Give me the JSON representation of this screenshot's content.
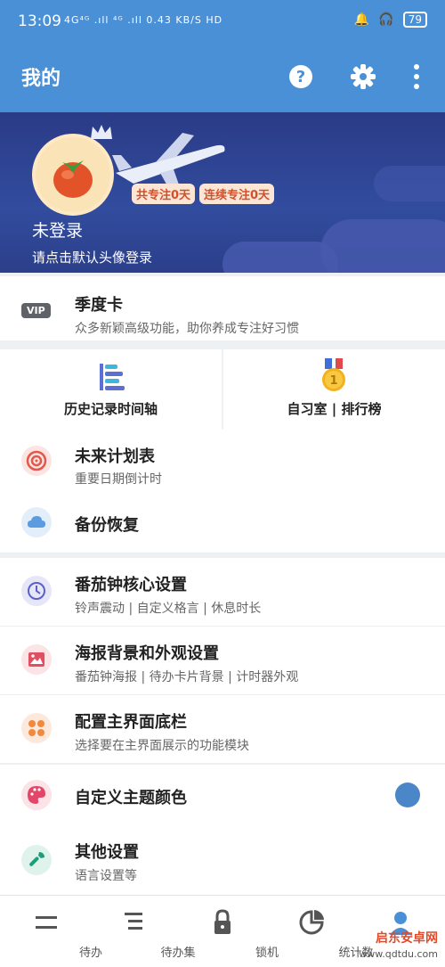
{
  "status": {
    "time": "13:09",
    "signal": "4G⁴ᴳ .ıll ⁴ᴳ .ıll 0.43 KB/S HD",
    "battery": "79"
  },
  "header": {
    "title": "我的"
  },
  "profile": {
    "badge_total": "共专注0天",
    "badge_streak": "连续专注0天",
    "name": "未登录",
    "hint": "请点击默认头像登录"
  },
  "vip": {
    "tag": "VIP",
    "title": "季度卡",
    "subtitle": "众多新颖高级功能，助你养成专注好习惯"
  },
  "grid": {
    "history": "历史记录时间轴",
    "study_room": "自习室 | 排行榜",
    "medal_number": "1"
  },
  "rows": {
    "future": {
      "title": "未来计划表",
      "subtitle": "重要日期倒计时"
    },
    "backup": {
      "title": "备份恢复"
    },
    "core": {
      "title": "番茄钟核心设置",
      "subtitle": "铃声震动 | 自定义格言 | 休息时长"
    },
    "poster": {
      "title": "海报背景和外观设置",
      "subtitle": "番茄钟海报 | 待办卡片背景 | 计时器外观"
    },
    "bottombar": {
      "title": "配置主界面底栏",
      "subtitle": "选择要在主界面展示的功能模块"
    },
    "theme": {
      "title": "自定义主题颜色"
    },
    "other": {
      "title": "其他设置",
      "subtitle": "语言设置等"
    }
  },
  "colors": {
    "primary": "#4a90d6",
    "theme_dot": "#4a86c8"
  },
  "tabs": [
    "待办",
    "待办集",
    "锁机",
    "统计数"
  ],
  "watermark": {
    "line1": "启东安卓网",
    "line2": "www.qdtdu.com"
  }
}
